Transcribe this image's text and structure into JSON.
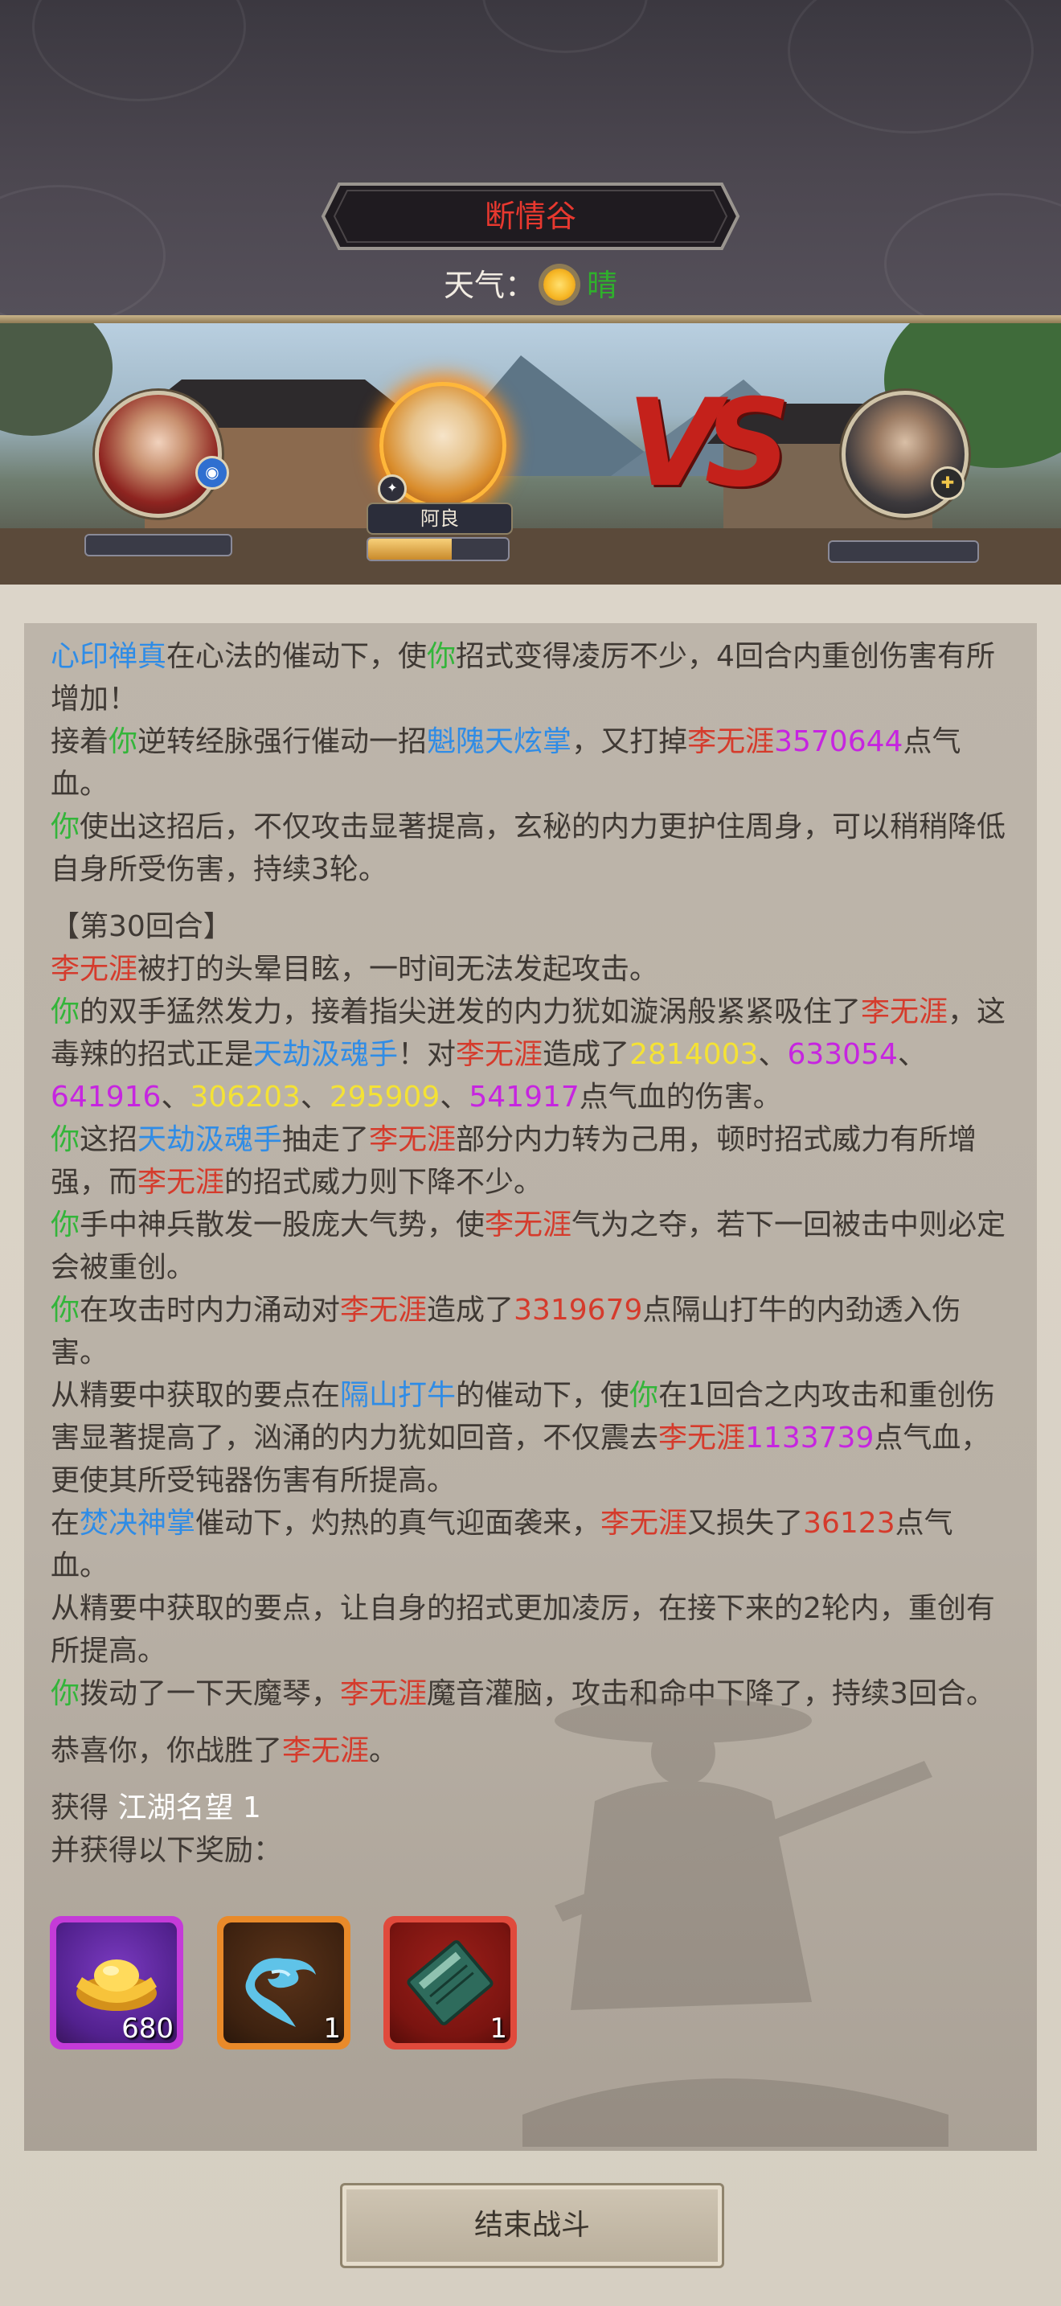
{
  "header": {
    "location_name": "断情谷",
    "weather_label": "天气：",
    "weather_icon": "sun-icon",
    "weather_value": "晴"
  },
  "battle": {
    "left_hero_badge_icon": "water-element-icon",
    "center_hero_name": "阿良",
    "center_hero_hp_fraction": 0.6,
    "vs_text": "VS",
    "right_hero_badge_icon": "gold-element-icon"
  },
  "log": {
    "l1": {
      "a": "心印禅真",
      "b": "在心法的催动下，使",
      "c": "你",
      "d": "招式变得凌厉不少，4回合内重创伤害有所增加！"
    },
    "l2": {
      "a": "接着",
      "b": "你",
      "c": "逆转经脉强行催动一招",
      "d": "魁隗天炫掌",
      "e": "，又打掉",
      "f": "李无涯",
      "g": "3570644",
      "h": "点气血。"
    },
    "l3": {
      "a": "你",
      "b": "使出这招后，不仅攻击显著提高，玄秘的内力更护住周身，可以稍稍降低自身所受伤害，持续3轮。"
    },
    "round": "【第30回合】",
    "l4": {
      "a": "李无涯",
      "b": "被打的头晕目眩，一时间无法发起攻击。"
    },
    "l5": {
      "a": "你",
      "b": "的双手猛然发力，接着指尖迸发的内力犹如漩涡般紧紧吸住了",
      "c": "李无涯",
      "d": "，这毒辣的招式正是",
      "e": "天劫汲魂手",
      "f": "！对",
      "g": "李无涯",
      "h": "造成了",
      "n1": "2814003",
      "s1": "、",
      "n2": "633054",
      "s2": "、",
      "n3": "641916",
      "s3": "、",
      "n4": "306203",
      "s4": "、",
      "n5": "295909",
      "s5": "、",
      "n6": "541917",
      "i": "点气血的伤害。"
    },
    "l6": {
      "a": "你",
      "b": "这招",
      "c": "天劫汲魂手",
      "d": "抽走了",
      "e": "李无涯",
      "f": "部分内力转为己用，顿时招式威力有所增强，而",
      "g": "李无涯",
      "h": "的招式威力则下降不少。"
    },
    "l7": {
      "a": "你",
      "b": "手中神兵散发一股庞大气势，使",
      "c": "李无涯",
      "d": "气为之夺，若下一回被击中则必定会被重创。"
    },
    "l8": {
      "a": "你",
      "b": "在攻击时内力涌动对",
      "c": "李无涯",
      "d": "造成了",
      "e": "3319679",
      "f": "点隔山打牛的内劲透入伤害。"
    },
    "l9": {
      "a": "从精要中获取的要点在",
      "b": "隔山打牛",
      "c": "的催动下，使",
      "d": "你",
      "e": "在1回合之内攻击和重创伤害显著提高了，汹涌的内力犹如回音，不仅震去",
      "f": "李无涯",
      "g": "1133739",
      "h": "点气血，更使其所受钝器伤害有所提高。"
    },
    "l10": {
      "a": "在",
      "b": "焚决神掌",
      "c": "催动下，灼热的真气迎面袭来，",
      "d": "李无涯",
      "e": "又损失了",
      "f": "36123",
      "g": "点气血。"
    },
    "l11": {
      "a": "从精要中获取的要点，让自身的招式更加凌厉，在接下来的2轮内，重创有所提高。"
    },
    "l12": {
      "a": "你",
      "b": "拨动了一下天魔琴，",
      "c": "李无涯",
      "d": "魔音灌脑，攻击和命中下降了，持续3回合。"
    }
  },
  "victory": {
    "a": "恭喜你，你战胜了",
    "b": "李无涯",
    "c": "。"
  },
  "rewards": {
    "gain_label": "获得 ",
    "gain_value": "江湖名望 1",
    "extra_label": "并获得以下奖励：",
    "items": [
      {
        "icon": "gold-ingot-icon",
        "count": "680",
        "frame_color": "#c43bd8"
      },
      {
        "icon": "blue-cloud-token-icon",
        "count": "1",
        "frame_color": "#e98a2a"
      },
      {
        "icon": "green-book-icon",
        "count": "1",
        "frame_color": "#e04a3c"
      }
    ]
  },
  "end_button_label": "结束战斗"
}
